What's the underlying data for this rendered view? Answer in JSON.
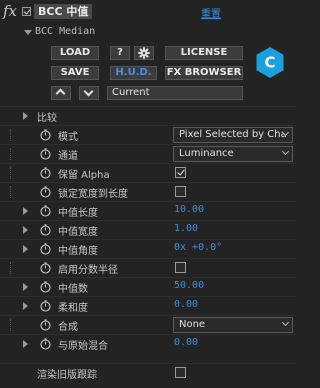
{
  "header": {
    "fx_glyph": "fx",
    "effect_name": "BCC 中值",
    "reset_label": "重置"
  },
  "plugin": {
    "name": "BCC Median"
  },
  "toolbar": {
    "load": "LOAD",
    "help": "?",
    "license": "LICENSE",
    "save": "SAVE",
    "hud": "H.U.D.",
    "fx_browser": "FX BROWSER",
    "preset": "Current",
    "logo_letter": "C",
    "colors": {
      "hud": "#4a8ef0",
      "logo": "#1aa0dc"
    }
  },
  "params": {
    "compare": {
      "label": "比较"
    },
    "mode": {
      "label": "模式",
      "value": "Pixel Selected by Cha"
    },
    "channel": {
      "label": "通道",
      "value": "Luminance"
    },
    "keep_alpha": {
      "label": "保留 Alpha",
      "checked": true
    },
    "lock_width": {
      "label": "锁定宽度到长度",
      "checked": false
    },
    "median_length": {
      "label": "中值长度",
      "value": "10.00"
    },
    "median_width": {
      "label": "中值宽度",
      "value": "1.00"
    },
    "median_angle": {
      "label": "中值角度",
      "value": "0x +0.0°"
    },
    "fractional_radius": {
      "label": "启用分数半径",
      "checked": false
    },
    "median_count": {
      "label": "中值数",
      "value": "50.00"
    },
    "softness": {
      "label": "柔和度",
      "value": "0.00"
    },
    "composite": {
      "label": "合成",
      "value": "None"
    },
    "mix_with_original": {
      "label": "与原始混合",
      "value": "0.00"
    },
    "legacy_render": {
      "label": "渲染旧版跟踪",
      "checked": false
    }
  },
  "colors": {
    "value_blue": "#3d8fe0",
    "background": "#232323"
  }
}
